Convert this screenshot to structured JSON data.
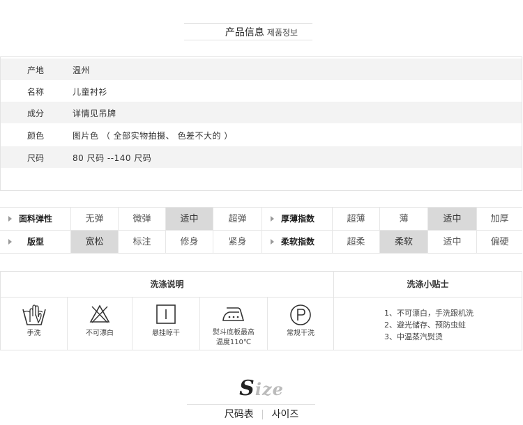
{
  "product_section": {
    "title": "产品信息",
    "subtitle": "제품정보"
  },
  "info": [
    {
      "label": "产地",
      "value": "温州"
    },
    {
      "label": "名称",
      "value": "儿童衬衫"
    },
    {
      "label": "成分",
      "value": "详情见吊牌"
    },
    {
      "label": "颜色",
      "value": "图片色 （ 全部实物拍摄、 色差不大的 ）"
    },
    {
      "label": "尺码",
      "value": "80 尺码 --140 尺码"
    }
  ],
  "properties": [
    {
      "label": "面料弹性",
      "options": [
        "无弹",
        "微弹",
        "适中",
        "超弹"
      ],
      "selected": 2
    },
    {
      "label": "厚薄指数",
      "options": [
        "超薄",
        "薄",
        "适中",
        "加厚"
      ],
      "selected": 2
    },
    {
      "label": "版型",
      "options": [
        "宽松",
        "标注",
        "修身",
        "紧身"
      ],
      "selected": 0
    },
    {
      "label": "柔软指数",
      "options": [
        "超柔",
        "柔软",
        "适中",
        "偏硬"
      ],
      "selected": 1
    }
  ],
  "wash": {
    "heading": "洗涤说明",
    "tips_heading": "洗涤小贴士",
    "items": [
      {
        "icon": "hand-wash-icon",
        "label": "手洗"
      },
      {
        "icon": "no-bleach-icon",
        "label": "不可漂白"
      },
      {
        "icon": "hang-dry-icon",
        "label": "悬挂晾干"
      },
      {
        "icon": "iron-icon",
        "label": "熨斗底板最高",
        "label2": "温度110℃"
      },
      {
        "icon": "dry-clean-icon",
        "label": "常规干洗"
      }
    ],
    "tips": [
      "1、不可漂白，手洗跟机洗",
      "2、避光储存、预防虫蛀",
      "3、中温蒸汽熨烫"
    ]
  },
  "size_section": {
    "word_initial": "S",
    "word_rest": "ize",
    "title": "尺码表",
    "subtitle": "사이즈"
  }
}
